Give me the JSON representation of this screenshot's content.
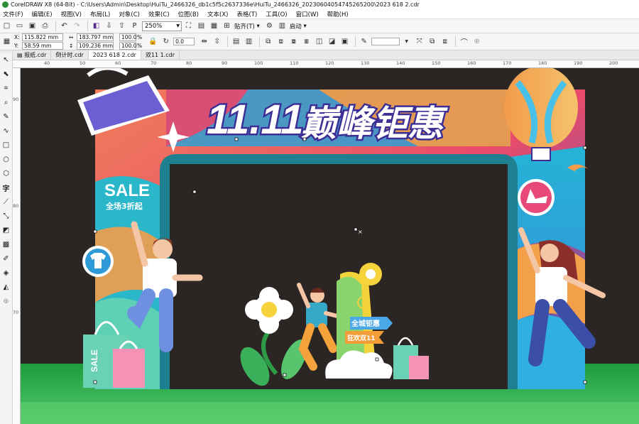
{
  "window": {
    "title": "CorelDRAW X8 (64-Bit) - C:\\Users\\Admin\\Desktop\\HuiTu_2466326_db1c5f5c2637336e\\HuiTu_2466326_20230604054745265200\\2023 618 2.cdr"
  },
  "menu": [
    "文件(F)",
    "编辑(E)",
    "视图(V)",
    "布局(L)",
    "对象(C)",
    "效果(C)",
    "位图(B)",
    "文本(X)",
    "表格(T)",
    "工具(O)",
    "窗口(W)",
    "帮助(H)"
  ],
  "toolbar": {
    "zoom": "250%",
    "align_label": "贴齐(T)",
    "launch_label": "启动"
  },
  "property_bar": {
    "x": "115.822 mm",
    "y": "58.59 mm",
    "w": "183.797 mm",
    "h": "109.236 mm",
    "scale_w": "100.0",
    "scale_h": "100.0",
    "pct": "%",
    "rotation": "0.0",
    "x_label": "X:",
    "y_label": "Y:"
  },
  "doc_tabs": [
    "报纸.cdr",
    "倒计时.cdr",
    "2023 618 2.cdr",
    "双11 1.cdr"
  ],
  "ruler": {
    "h_labels": [
      "40",
      "50",
      "60",
      "70",
      "80",
      "90",
      "100",
      "110",
      "120",
      "130",
      "140",
      "150",
      "160",
      "170",
      "180",
      "190",
      "200"
    ],
    "v_labels": [
      "",
      "90",
      "",
      "",
      "80",
      "",
      "",
      "70",
      "",
      ""
    ]
  },
  "artwork": {
    "headline_num": "11.11",
    "headline_text": "巅峰钜惠",
    "sale": "SALE",
    "sale_sub": "全场3折起",
    "tag1": "全城钜惠",
    "tag2": "狂欢双11",
    "bag_text": "SALE"
  },
  "colors": {
    "canvas_bg": "#2b2624",
    "grass": "#2ea84a",
    "arch_teal": "#1e7f90",
    "headline": "#3b2f95"
  }
}
